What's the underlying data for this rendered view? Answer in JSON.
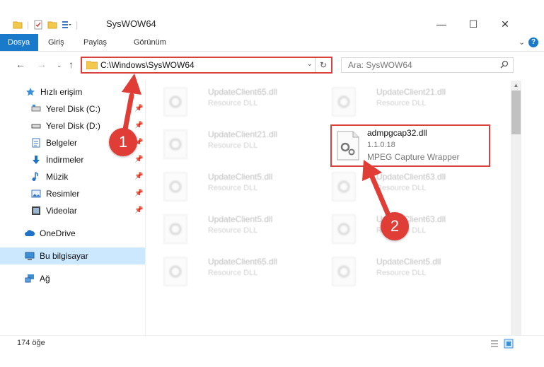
{
  "window": {
    "title": "SysWOW64",
    "controls": {
      "minimize": "—",
      "maximize": "☐",
      "close": "✕"
    }
  },
  "ribbon": {
    "tabs": [
      "Dosya",
      "Giriş",
      "Paylaş",
      "Görünüm"
    ],
    "help_label": "?"
  },
  "address": {
    "path": "C:\\Windows\\SysWOW64",
    "search_placeholder": "Ara: SysWOW64"
  },
  "sidebar": {
    "items": [
      {
        "label": "Hızlı erişim",
        "icon": "star-icon",
        "pinned": false
      },
      {
        "label": "Yerel Disk (C:)",
        "icon": "drive-icon",
        "pinned": true
      },
      {
        "label": "Yerel Disk (D:)",
        "icon": "drive-icon",
        "pinned": true
      },
      {
        "label": "Belgeler",
        "icon": "document-icon",
        "pinned": true
      },
      {
        "label": "İndirmeler",
        "icon": "download-icon",
        "pinned": true
      },
      {
        "label": "Müzik",
        "icon": "music-icon",
        "pinned": true
      },
      {
        "label": "Resimler",
        "icon": "picture-icon",
        "pinned": true
      },
      {
        "label": "Videolar",
        "icon": "video-icon",
        "pinned": true
      },
      {
        "label": "OneDrive",
        "icon": "cloud-icon",
        "pinned": false
      },
      {
        "label": "Bu bilgisayar",
        "icon": "computer-icon",
        "pinned": false
      },
      {
        "label": "Ağ",
        "icon": "network-icon",
        "pinned": false
      }
    ]
  },
  "files": [
    {
      "name": "UpdateClient65.dll",
      "desc": "Resource DLL"
    },
    {
      "name": "UpdateClient21.dll",
      "desc": "Resource DLL"
    },
    {
      "name": "UpdateClient21.dll",
      "desc": "Resource DLL"
    },
    {
      "name": "UpdateClient5.dll",
      "desc": "Resource DLL"
    },
    {
      "name": "UpdateClient63.dll",
      "desc": "Resource DLL"
    },
    {
      "name": "UpdateClient5.dll",
      "desc": "Resource DLL"
    },
    {
      "name": "UpdateClient63.dll",
      "desc": "Resource DLL"
    },
    {
      "name": "UpdateClient65.dll",
      "desc": "Resource DLL"
    },
    {
      "name": "UpdateClient5.dll",
      "desc": "Resource DLL"
    }
  ],
  "highlighted_file": {
    "name": "admpgcap32.dll",
    "version": "1.1.0.18",
    "description": "MPEG Capture Wrapper"
  },
  "annotations": {
    "step1": "1",
    "step2": "2"
  },
  "status": {
    "item_count": "174 öğe"
  },
  "colors": {
    "accent": "#1979ca",
    "annotation": "#e03d37",
    "selected": "#cce8ff"
  }
}
